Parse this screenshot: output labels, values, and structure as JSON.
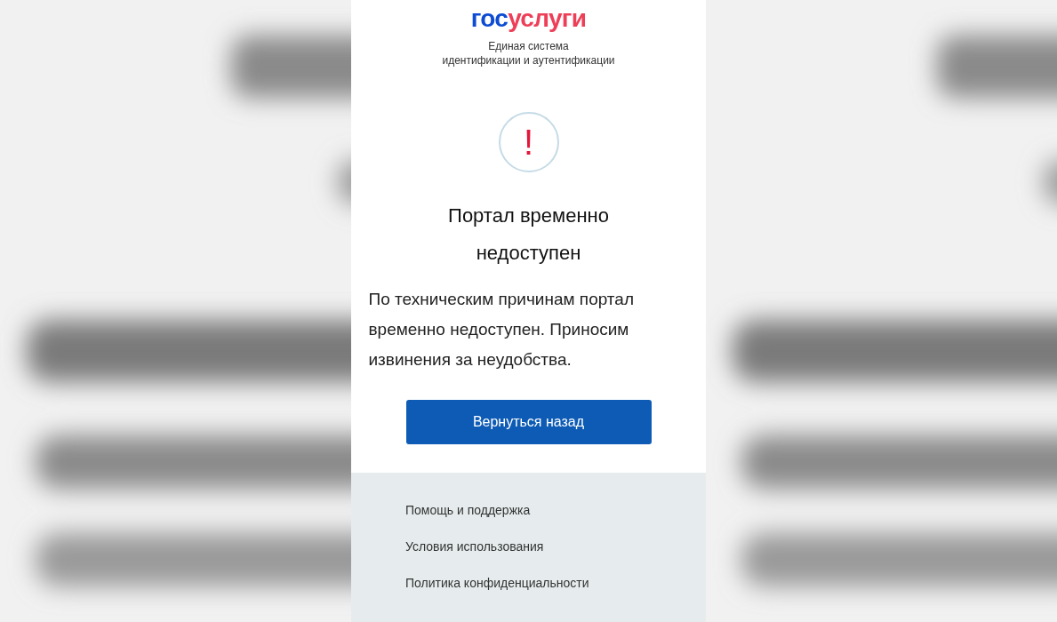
{
  "logo": {
    "part1": "гос",
    "part2": "услуги"
  },
  "subtitle": [
    "Единая система",
    "идентификации и аутентификации"
  ],
  "error_icon": "!",
  "heading": "Портал временно недоступен",
  "message": "По техническим причинам портал временно недоступен. Приносим извинения за неудобства.",
  "back_button": "Вернуться назад",
  "footer_links": [
    "Помощь и поддержка",
    "Условия использования",
    "Политика конфиденциальности"
  ]
}
